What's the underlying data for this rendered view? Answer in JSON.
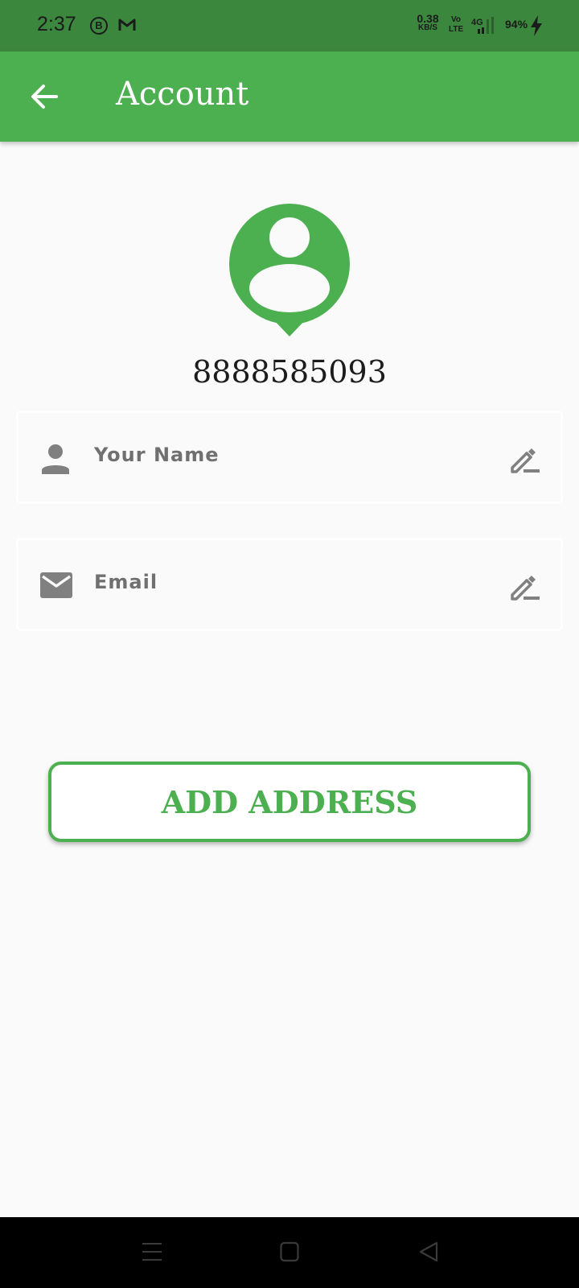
{
  "status_bar": {
    "time": "2:37",
    "notification_b": "B",
    "net_speed_value": "0.38",
    "net_speed_unit": "KB/S",
    "volte_line1": "Vo",
    "volte_line2": "LTE",
    "network": "4G",
    "battery": "94%"
  },
  "app_bar": {
    "title": "Account",
    "back_icon": "arrow-left-icon"
  },
  "profile": {
    "avatar_icon": "account-pin-icon",
    "phone": "8888585093"
  },
  "fields": {
    "name": {
      "icon": "person-icon",
      "placeholder": "Your Name",
      "edit_icon": "edit-pencil-icon"
    },
    "email": {
      "icon": "mail-icon",
      "placeholder": "Email",
      "edit_icon": "edit-pencil-icon"
    }
  },
  "button": {
    "label": "ADD ADDRESS"
  },
  "colors": {
    "primary": "#4caf50",
    "status_bar": "#3b873e",
    "background": "#fafafa",
    "icon_gray": "#808080"
  }
}
